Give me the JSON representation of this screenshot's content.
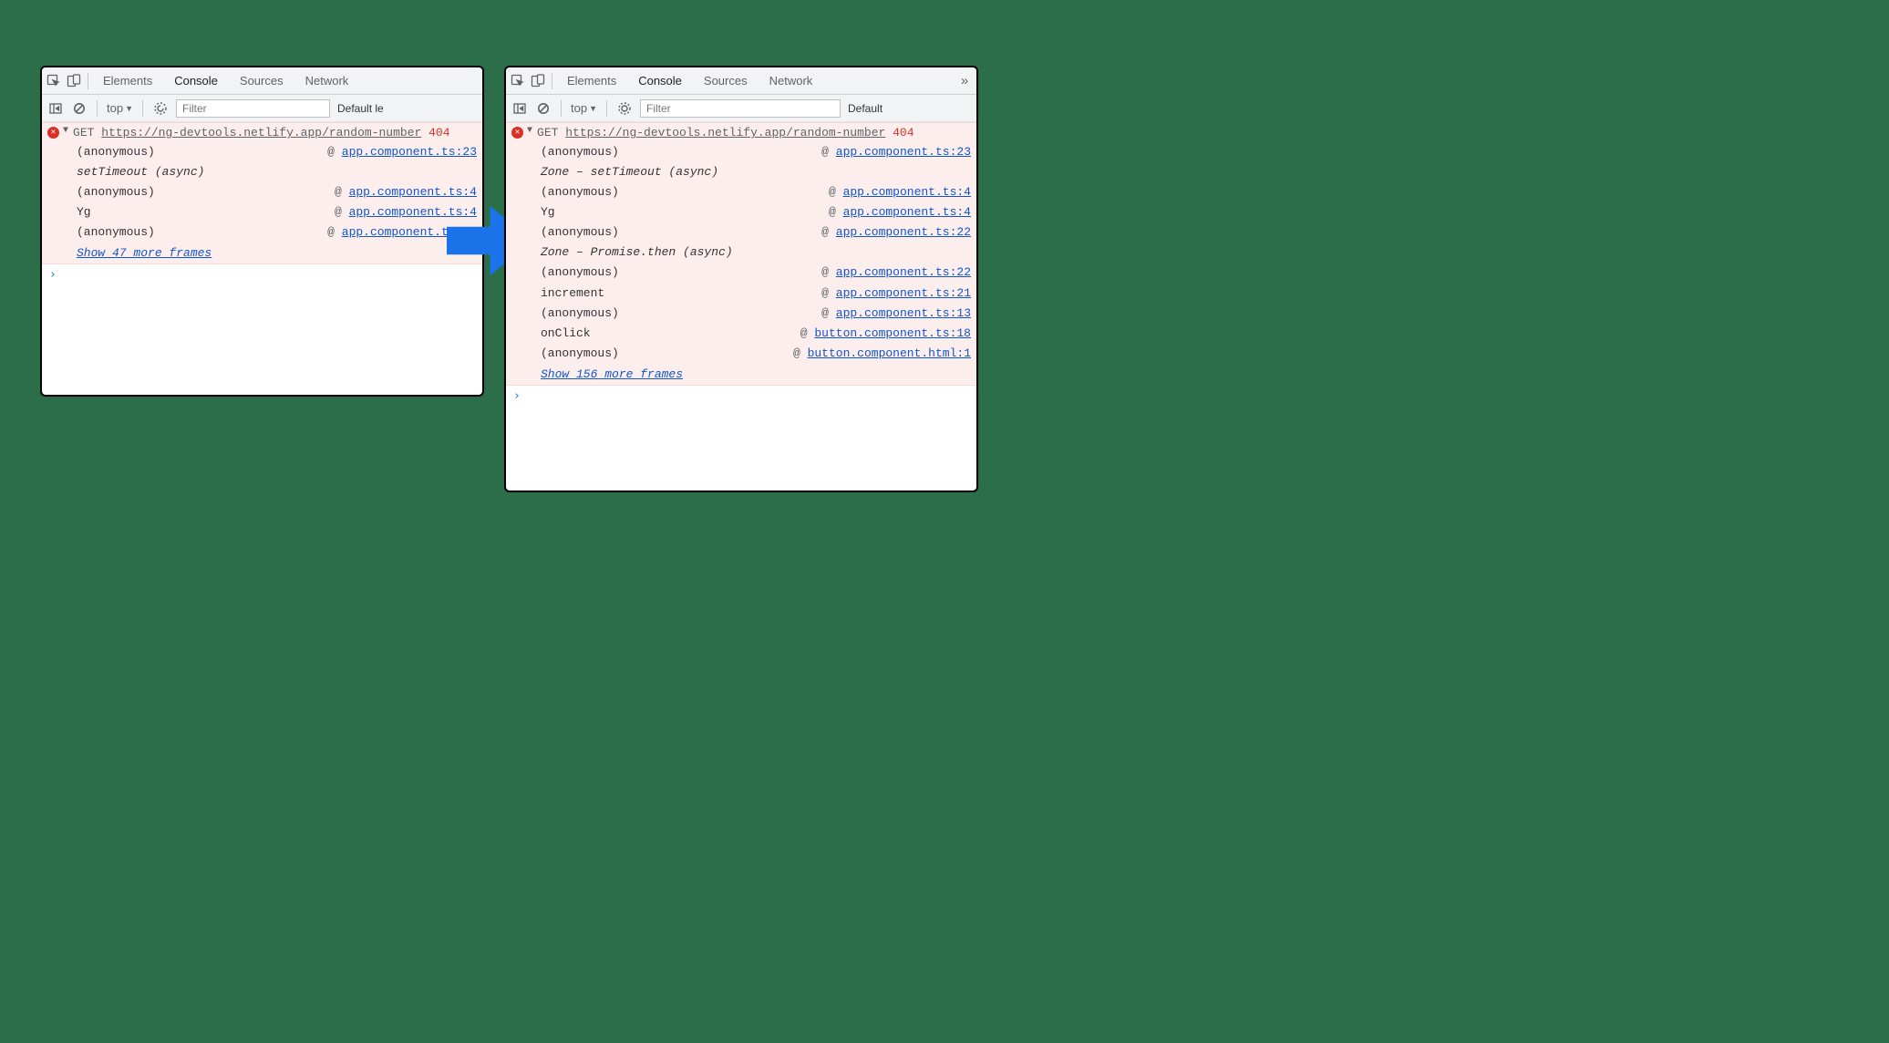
{
  "tabs": {
    "elements": "Elements",
    "console": "Console",
    "sources": "Sources",
    "network": "Network"
  },
  "toolbar": {
    "context": "top",
    "filter_placeholder": "Filter",
    "levels_left": "Default le",
    "levels_right": "Default"
  },
  "left": {
    "method": "GET",
    "url": "https://ng-devtools.netlify.app/random-number",
    "status": "404",
    "frames": [
      {
        "fn": "(anonymous)",
        "src": "app.component.ts:23"
      }
    ],
    "async1": "setTimeout (async)",
    "frames2": [
      {
        "fn": "(anonymous)",
        "src": "app.component.ts:4"
      },
      {
        "fn": "Yg",
        "src": "app.component.ts:4"
      },
      {
        "fn": "(anonymous)",
        "src": "app.component.ts:22"
      }
    ],
    "showmore": "Show 47 more frames"
  },
  "right": {
    "method": "GET",
    "url": "https://ng-devtools.netlify.app/random-number",
    "status": "404",
    "frames": [
      {
        "fn": "(anonymous)",
        "src": "app.component.ts:23"
      }
    ],
    "async1": "Zone – setTimeout (async)",
    "frames2": [
      {
        "fn": "(anonymous)",
        "src": "app.component.ts:4"
      },
      {
        "fn": "Yg",
        "src": "app.component.ts:4"
      },
      {
        "fn": "(anonymous)",
        "src": "app.component.ts:22"
      }
    ],
    "async2": "Zone – Promise.then (async)",
    "frames3": [
      {
        "fn": "(anonymous)",
        "src": "app.component.ts:22"
      },
      {
        "fn": "increment",
        "src": "app.component.ts:21"
      },
      {
        "fn": "(anonymous)",
        "src": "app.component.ts:13"
      },
      {
        "fn": "onClick",
        "src": "button.component.ts:18"
      },
      {
        "fn": "(anonymous)",
        "src": "button.component.html:1"
      }
    ],
    "showmore": "Show 156 more frames"
  }
}
